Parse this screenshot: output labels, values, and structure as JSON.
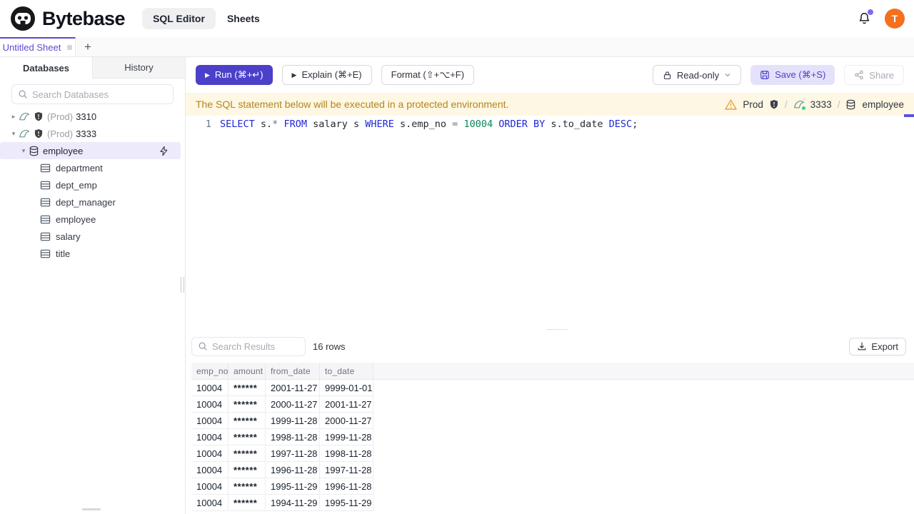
{
  "topbar": {
    "brand": "Bytebase",
    "nav_sql_editor": "SQL Editor",
    "nav_sheets": "Sheets",
    "avatar_initial": "T"
  },
  "tabstrip": {
    "active_tab": "Untitled Sheet",
    "new_tab_glyph": "+"
  },
  "sidebar": {
    "tab_databases": "Databases",
    "tab_history": "History",
    "search_placeholder": "Search Databases",
    "instances": [
      {
        "caret": "▸",
        "env": "(Prod)",
        "name": "3310"
      },
      {
        "caret": "▾",
        "env": "(Prod)",
        "name": "3333"
      }
    ],
    "database": {
      "caret": "▾",
      "name": "employee"
    },
    "tables": [
      "department",
      "dept_emp",
      "dept_manager",
      "employee",
      "salary",
      "title"
    ]
  },
  "toolbar": {
    "run_play": "▶",
    "run": "Run (⌘+↵)",
    "explain_play": "▶",
    "explain": "Explain (⌘+E)",
    "format": "Format (⇧+⌥+F)",
    "readonly": "Read-only",
    "save": "Save (⌘+S)",
    "share": "Share"
  },
  "banner": {
    "message": "The SQL statement below will be executed in a protected environment.",
    "environment": "Prod",
    "separator1": "/",
    "instance": "3333",
    "separator2": "/",
    "database": "employee"
  },
  "editor": {
    "line_number": "1",
    "sql_text": "SELECT s.* FROM salary s WHERE s.emp_no = 10004 ORDER BY s.to_date DESC;",
    "tokens": [
      {
        "t": "SELECT",
        "c": "kw"
      },
      {
        "t": " s.",
        "c": "pl"
      },
      {
        "t": "*",
        "c": "op"
      },
      {
        "t": " ",
        "c": "pl"
      },
      {
        "t": "FROM",
        "c": "kw"
      },
      {
        "t": " salary s ",
        "c": "pl"
      },
      {
        "t": "WHERE",
        "c": "kw"
      },
      {
        "t": " s.emp_no ",
        "c": "pl"
      },
      {
        "t": "=",
        "c": "op"
      },
      {
        "t": " ",
        "c": "pl"
      },
      {
        "t": "10004",
        "c": "num"
      },
      {
        "t": " ",
        "c": "pl"
      },
      {
        "t": "ORDER BY",
        "c": "kw"
      },
      {
        "t": " s.to_date ",
        "c": "pl"
      },
      {
        "t": "DESC",
        "c": "kw"
      },
      {
        "t": ";",
        "c": "pl"
      }
    ]
  },
  "results": {
    "search_placeholder": "Search Results",
    "row_count": "16 rows",
    "export": "Export",
    "columns": [
      "emp_no",
      "amount",
      "from_date",
      "to_date"
    ],
    "rows": [
      [
        "10004",
        "******",
        "2001-11-27",
        "9999-01-01"
      ],
      [
        "10004",
        "******",
        "2000-11-27",
        "2001-11-27"
      ],
      [
        "10004",
        "******",
        "1999-11-28",
        "2000-11-27"
      ],
      [
        "10004",
        "******",
        "1998-11-28",
        "1999-11-28"
      ],
      [
        "10004",
        "******",
        "1997-11-28",
        "1998-11-28"
      ],
      [
        "10004",
        "******",
        "1996-11-28",
        "1997-11-28"
      ],
      [
        "10004",
        "******",
        "1995-11-29",
        "1996-11-28"
      ],
      [
        "10004",
        "******",
        "1994-11-29",
        "1995-11-29"
      ]
    ]
  },
  "colors": {
    "brand_indigo": "#4b40c9",
    "save_bg": "#e4e2fb",
    "selected_tree_bg": "#edebfb",
    "banner_bg": "#fdf7e4",
    "banner_text": "#b5841c",
    "warning_icon": "#e8a33d",
    "avatar_orange": "#f4701d",
    "keyword_blue": "#2028d2",
    "number_green": "#098658",
    "connection_green": "#34d399"
  }
}
